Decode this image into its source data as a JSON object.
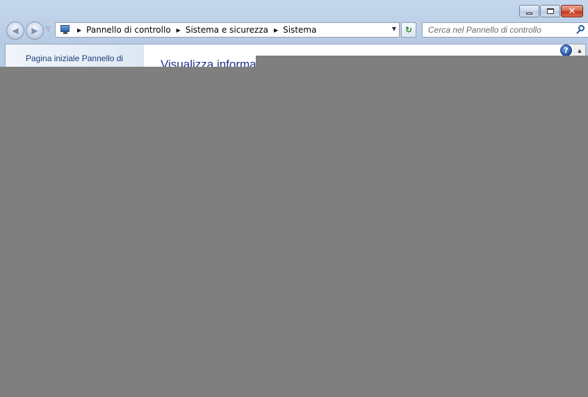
{
  "window": {
    "buttons": {
      "minimize": "minimize",
      "maximize": "maximize",
      "close": "✕"
    }
  },
  "navigation": {
    "back": "◀",
    "forward": "▶",
    "history": "▽",
    "breadcrumbs": [
      "Pannello di controllo",
      "Sistema e sicurezza",
      "Sistema"
    ],
    "dropdown": "▼",
    "refresh": "↻"
  },
  "search": {
    "placeholder": "Cerca nel Pannello di controllo"
  },
  "sidebar": {
    "home_link": "Pagina iniziale Pannello di controllo"
  },
  "content": {
    "title": "Visualizza informazioni di base sul computer",
    "help": "?"
  },
  "colors": {
    "overlay": "#7f7f7f",
    "link": "#1a3d78",
    "title": "#1e3287"
  }
}
